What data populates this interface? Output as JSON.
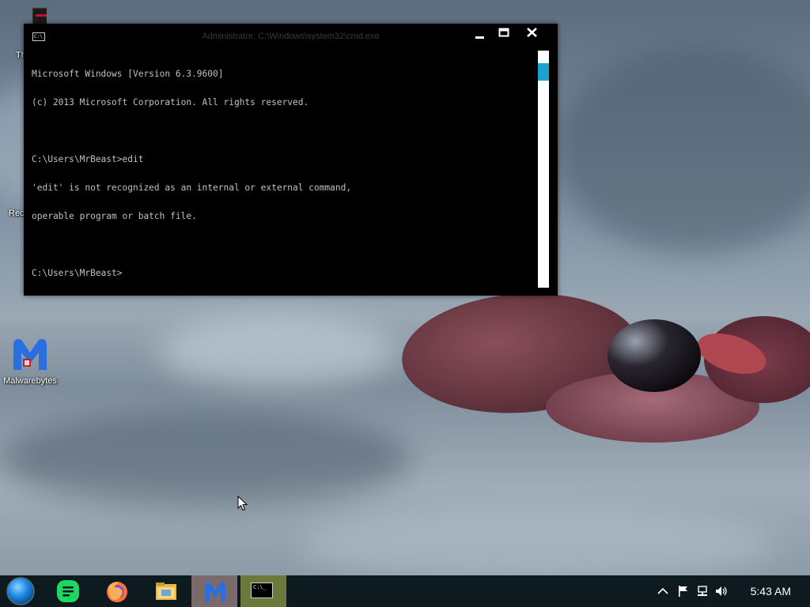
{
  "desktop": {
    "icons": [
      {
        "label": "Th"
      },
      {
        "label": "Rec"
      },
      {
        "label": "Malwarebytes"
      }
    ]
  },
  "cmd_window": {
    "title": "Administrator: C:\\Windows\\system32\\cmd.exe",
    "title_icon_text": "C:\\",
    "lines": [
      "Microsoft Windows [Version 6.3.9600]",
      "(c) 2013 Microsoft Corporation. All rights reserved.",
      "",
      "C:\\Users\\MrBeast>edit",
      "'edit' is not recognized as an internal or external command,",
      "operable program or batch file.",
      "",
      "C:\\Users\\MrBeast>"
    ]
  },
  "taskbar": {
    "start_icon": "start-orb-icon",
    "apps": [
      {
        "name": "spotify",
        "icon": "spotify-icon"
      },
      {
        "name": "firefox",
        "icon": "firefox-icon"
      },
      {
        "name": "file-explorer",
        "icon": "folder-icon"
      },
      {
        "name": "malwarebytes",
        "icon": "malwarebytes-icon"
      },
      {
        "name": "cmd",
        "icon": "cmd-icon",
        "icon_text": "C:\\_"
      }
    ],
    "tray": {
      "icons": [
        "chevron-up-icon",
        "flag-icon",
        "network-icon",
        "volume-icon"
      ]
    },
    "clock": "5:43 AM"
  },
  "colors": {
    "taskbar_bg": "#0d1b20",
    "cmd_text": "#c0c0c0",
    "scroll_thumb": "#1aa3cf",
    "malwarebytes_btn": "#7a6a6c",
    "cmd_btn": "#6b7a3a",
    "spotify": "#1ed760"
  }
}
